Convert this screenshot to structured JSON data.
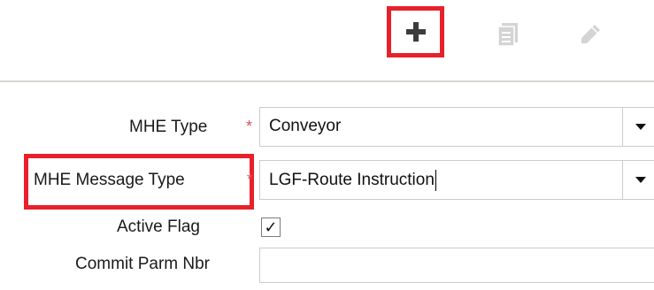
{
  "toolbar": {
    "add_icon": "plus-icon",
    "copy_icon": "document-copy-icon",
    "edit_icon": "pencil-icon"
  },
  "form": {
    "mhe_type": {
      "label": "MHE Type",
      "required_marker": "*",
      "value": "Conveyor"
    },
    "mhe_message_type": {
      "label": "MHE Message Type",
      "required_marker": "*",
      "value": "LGF-Route Instruction"
    },
    "active_flag": {
      "label": "Active Flag",
      "checked": true,
      "check_mark": "✓"
    },
    "commit_parm_nbr": {
      "label": "Commit Parm Nbr",
      "value": ""
    }
  },
  "colors": {
    "highlight": "#e8202a",
    "required": "#d9534f",
    "icon_active": "#3c3c3c",
    "icon_disabled": "#d4d4d4"
  }
}
